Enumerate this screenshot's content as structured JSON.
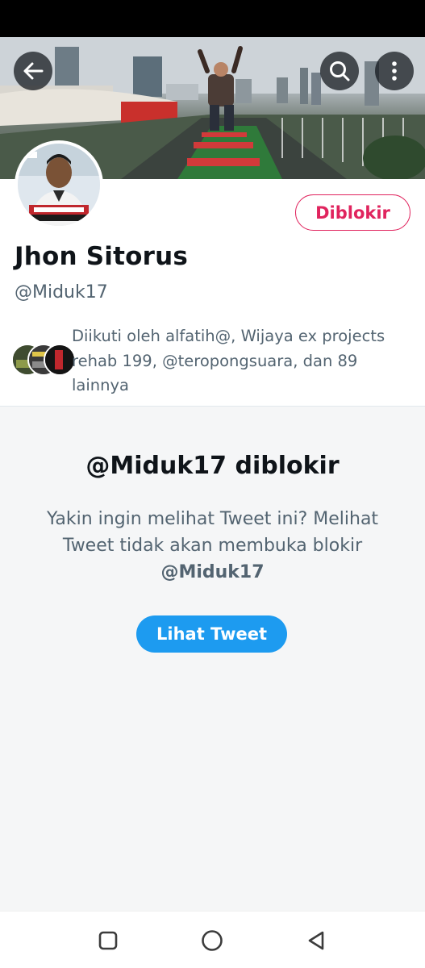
{
  "profile": {
    "display_name": "Jhon Sitorus",
    "handle": "@Miduk17",
    "blocked_label": "Diblokir",
    "followed_by_text": "Diikuti oleh alfatih@, Wijaya ex projects rehab 199, @teropongsuara, dan 89 lainnya"
  },
  "blocked_notice": {
    "title": "@Miduk17 diblokir",
    "message": "Yakin ingin melihat Tweet ini? Melihat Tweet tidak akan membuka blokir",
    "handle": "@Miduk17",
    "view_button_label": "Lihat Tweet"
  },
  "icons": {
    "back": "arrow-left-icon",
    "search": "search-icon",
    "more": "more-vertical-icon",
    "nav_recents": "square-icon",
    "nav_home": "circle-icon",
    "nav_back": "triangle-back-icon"
  },
  "colors": {
    "accent_blue": "#1d9bf0",
    "blocked_red": "#e0245e",
    "secondary_text": "#536471",
    "panel_bg": "#f5f6f7"
  }
}
